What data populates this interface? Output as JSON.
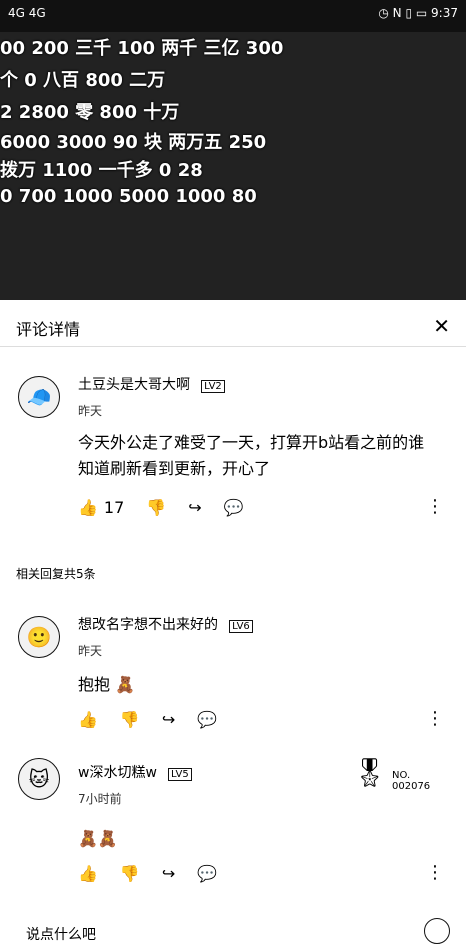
{
  "status": {
    "signal": "4G 4G",
    "time": "9:37",
    "icons": [
      "wifi-icon",
      "alarm-icon",
      "nfc-icon",
      "vibrate-icon",
      "battery-icon"
    ]
  },
  "video": {
    "danmaku": [
      {
        "text": "00 200 三千 100 两千 三亿 300"
      },
      {
        "text": "个 0 八百 800 二万"
      },
      {
        "text": "2 2800 零 800 十万"
      },
      {
        "text": "6000 3000 90 块 两万五 250"
      },
      {
        "text": "拨万 1100 一千多 0 28"
      },
      {
        "text": "0 700 1000 5000 1000 80"
      }
    ]
  },
  "panel": {
    "title": "评论详情"
  },
  "main_comment": {
    "author": "土豆头是大哥大啊",
    "level": "LV2",
    "time": "昨天",
    "text": "今天外公走了难受了一天，打算开b站看之前的谁知道刷新看到更新，开心了",
    "likes": "17"
  },
  "replies_header": "相关回复共5条",
  "replies": [
    {
      "author": "想改名字想不出来好的",
      "level": "LV6",
      "time": "昨天",
      "text": "抱抱"
    },
    {
      "author": "w深水切糕w",
      "level": "LV5",
      "time": "7小时前",
      "text": "",
      "badge": "NO. 002076"
    }
  ],
  "footer": {
    "placeholder": "说点什么吧"
  }
}
